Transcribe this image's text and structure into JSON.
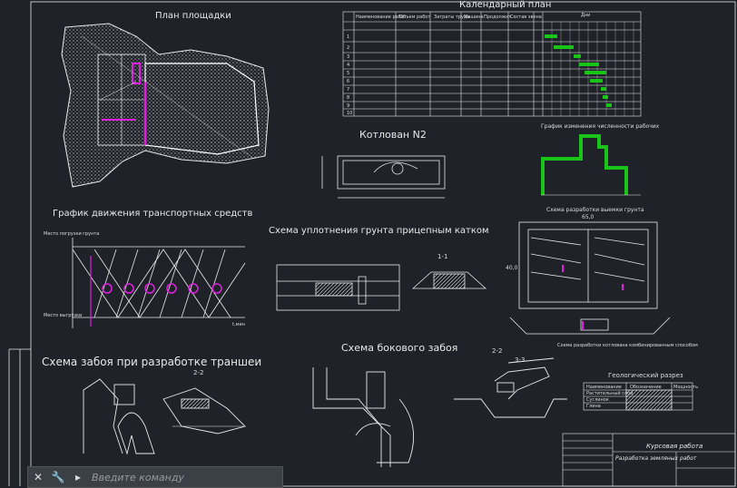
{
  "drawing": {
    "site_plan_title": "План площадки",
    "calendar_title": "Календарный план",
    "pit_title": "Котлован N2",
    "transport_title": "График движения транспортных средств",
    "compaction_title": "Схема уплотнения грунта прицепным катком",
    "trench_title": "Схема забоя при разработке траншеи",
    "side_face_title": "Схема бокового забоя",
    "workers_chart_title": "График изменения численности рабочих",
    "geology_title": "Геологический разрез",
    "section_11": "1-1",
    "section_22_left": "2-2",
    "section_22_right": "2-2",
    "section_33": "3-3",
    "scheme_title": "Схема разработки выемки грунта",
    "scheme_bottom_caption": "Схема разработки котлована комбинированным способом",
    "pit_dim": "65,0",
    "pit_height": "40,0",
    "axis_left_top": "Место погрузки грунта",
    "axis_left_bottom": "Место выгрузки",
    "axis_right": "t,мин",
    "tb_project": "Курсовая работа",
    "tb_subject": "Разработка земляных работ",
    "geo_rows": [
      "Растительный слой",
      "Суглинок",
      "Глина"
    ],
    "geo_header": [
      "Наименование",
      "Обозначение",
      "Мощность"
    ],
    "calendar_header": [
      "Наименование работ",
      "Объем работ",
      "Затраты труда",
      "Машина",
      "Продолжит.",
      "Состав звена",
      "Дни"
    ],
    "stage_labels": [
      "1",
      "2",
      "3",
      "4",
      "5",
      "6",
      "7",
      "8",
      "9",
      "10"
    ]
  },
  "command": {
    "placeholder": "Введите команду",
    "close_icon": "close-icon",
    "settings_icon": "wrench-icon",
    "prompt_icon": "prompt-icon"
  },
  "colors": {
    "background": "#1f2329",
    "line": "#e8e8e8",
    "accent_magenta": "#e020e0",
    "accent_green": "#19c419"
  }
}
